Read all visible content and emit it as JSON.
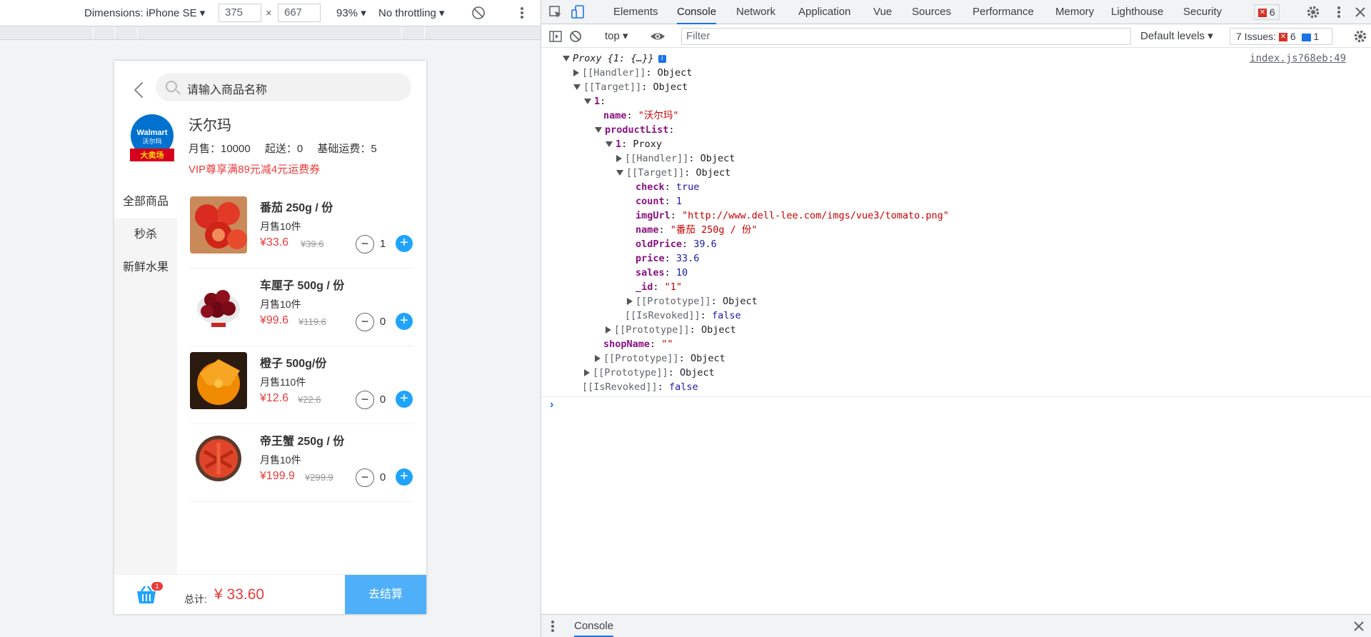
{
  "device_toolbar": {
    "dimensions_label": "Dimensions: iPhone SE",
    "width": "375",
    "height": "667",
    "times": "×",
    "zoom": "93%",
    "throttling": "No throttling"
  },
  "app": {
    "search_placeholder": "请输入商品名称",
    "shop": {
      "name": "沃尔玛",
      "monthly_sales": "月售：10000",
      "min_order": "起送：0",
      "delivery_fee": "基础运费：5",
      "promo": "VIP尊享满89元减4元运费券",
      "logo_text_1": "Walmart",
      "logo_text_2": "沃尔玛",
      "logo_banner": "大卖场"
    },
    "sidebar": [
      "全部商品",
      "秒杀",
      "新鲜水果"
    ],
    "products": [
      {
        "name": "番茄 250g / 份",
        "sales": "月售10件",
        "price": "¥33.6",
        "old_price": "¥39.6",
        "count": "1"
      },
      {
        "name": "车厘子 500g / 份",
        "sales": "月售10件",
        "price": "¥99.6",
        "old_price": "¥119.6",
        "count": "0"
      },
      {
        "name": "橙子 500g/份",
        "sales": "月售110件",
        "price": "¥12.6",
        "old_price": "¥22.6",
        "count": "0"
      },
      {
        "name": "帝王蟹 250g / 份",
        "sales": "月售10件",
        "price": "¥199.9",
        "old_price": "¥299.9",
        "count": "0"
      }
    ],
    "cart": {
      "badge": "1",
      "total_label": "总计:",
      "total_value": "¥ 33.60",
      "checkout_label": "去结算"
    }
  },
  "devtools": {
    "tabs": [
      "Elements",
      "Console",
      "Network",
      "Application",
      "Vue",
      "Sources",
      "Performance",
      "Memory",
      "Lighthouse",
      "Security"
    ],
    "active_tab": "Console",
    "error_count": "6",
    "context": "top",
    "filter_placeholder": "Filter",
    "levels": "Default levels",
    "issues_label": "7 Issues:",
    "issues_errors": "6",
    "issues_info": "1",
    "source_link": "index.js?68eb:49",
    "drawer_tab": "Console",
    "console_lines": [
      {
        "indent": 0,
        "toggle": "down",
        "key": "Proxy {1: {…}}",
        "sep": "",
        "val": "",
        "kcls": "kg",
        "vcls": ""
      },
      {
        "indent": 1,
        "toggle": "right",
        "key": "[[Handler]]",
        "sep": ": ",
        "val": "Object",
        "kcls": "kg",
        "vcls": ""
      },
      {
        "indent": 1,
        "toggle": "down",
        "key": "[[Target]]",
        "sep": ": ",
        "val": "Object",
        "kcls": "kg",
        "vcls": ""
      },
      {
        "indent": 2,
        "toggle": "down",
        "key": "1",
        "sep": ":",
        "val": "",
        "kcls": "k",
        "vcls": ""
      },
      {
        "indent": 3,
        "toggle": "",
        "key": "name",
        "sep": ": ",
        "val": "\"沃尔玛\"",
        "kcls": "k",
        "vcls": "s"
      },
      {
        "indent": 3,
        "toggle": "down",
        "key": "productList",
        "sep": ":",
        "val": "",
        "kcls": "k",
        "vcls": ""
      },
      {
        "indent": 4,
        "toggle": "down",
        "key": "1",
        "sep": ": ",
        "val": "Proxy",
        "kcls": "k",
        "vcls": ""
      },
      {
        "indent": 5,
        "toggle": "right",
        "key": "[[Handler]]",
        "sep": ": ",
        "val": "Object",
        "kcls": "kg",
        "vcls": ""
      },
      {
        "indent": 5,
        "toggle": "down",
        "key": "[[Target]]",
        "sep": ": ",
        "val": "Object",
        "kcls": "kg",
        "vcls": ""
      },
      {
        "indent": 6,
        "toggle": "",
        "key": "check",
        "sep": ": ",
        "val": "true",
        "kcls": "k",
        "vcls": "b"
      },
      {
        "indent": 6,
        "toggle": "",
        "key": "count",
        "sep": ": ",
        "val": "1",
        "kcls": "k",
        "vcls": "n"
      },
      {
        "indent": 6,
        "toggle": "",
        "key": "imgUrl",
        "sep": ": ",
        "val": "\"http://www.dell-lee.com/imgs/vue3/tomato.png\"",
        "kcls": "k",
        "vcls": "s"
      },
      {
        "indent": 6,
        "toggle": "",
        "key": "name",
        "sep": ": ",
        "val": "\"番茄 250g / 份\"",
        "kcls": "k",
        "vcls": "s"
      },
      {
        "indent": 6,
        "toggle": "",
        "key": "oldPrice",
        "sep": ": ",
        "val": "39.6",
        "kcls": "k",
        "vcls": "n"
      },
      {
        "indent": 6,
        "toggle": "",
        "key": "price",
        "sep": ": ",
        "val": "33.6",
        "kcls": "k",
        "vcls": "n"
      },
      {
        "indent": 6,
        "toggle": "",
        "key": "sales",
        "sep": ": ",
        "val": "10",
        "kcls": "k",
        "vcls": "n"
      },
      {
        "indent": 6,
        "toggle": "",
        "key": "_id",
        "sep": ": ",
        "val": "\"1\"",
        "kcls": "k",
        "vcls": "s"
      },
      {
        "indent": 6,
        "toggle": "right",
        "key": "[[Prototype]]",
        "sep": ": ",
        "val": "Object",
        "kcls": "kg",
        "vcls": ""
      },
      {
        "indent": 5,
        "toggle": "",
        "key": "[[IsRevoked]]",
        "sep": ": ",
        "val": "false",
        "kcls": "kg",
        "vcls": "b"
      },
      {
        "indent": 4,
        "toggle": "right",
        "key": "[[Prototype]]",
        "sep": ": ",
        "val": "Object",
        "kcls": "kg",
        "vcls": ""
      },
      {
        "indent": 3,
        "toggle": "",
        "key": "shopName",
        "sep": ": ",
        "val": "\"\"",
        "kcls": "k",
        "vcls": "s"
      },
      {
        "indent": 3,
        "toggle": "right",
        "key": "[[Prototype]]",
        "sep": ": ",
        "val": "Object",
        "kcls": "kg",
        "vcls": ""
      },
      {
        "indent": 2,
        "toggle": "right",
        "key": "[[Prototype]]",
        "sep": ": ",
        "val": "Object",
        "kcls": "kg",
        "vcls": ""
      },
      {
        "indent": 1,
        "toggle": "",
        "key": "[[IsRevoked]]",
        "sep": ": ",
        "val": "false",
        "kcls": "kg",
        "vcls": "b"
      }
    ]
  }
}
